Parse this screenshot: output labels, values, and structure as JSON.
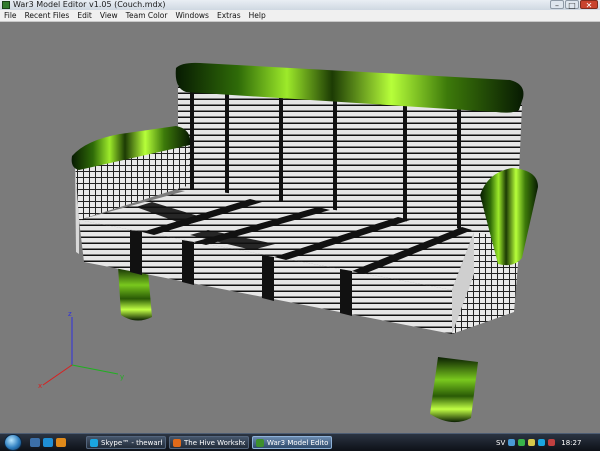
{
  "window": {
    "title": "War3 Model Editor v1.05 (Couch.mdx)",
    "controls": {
      "minimize": "–",
      "maximize": "□",
      "close": "✕"
    }
  },
  "menubar": {
    "items": [
      "File",
      "Recent Files",
      "Edit",
      "View",
      "Team Color",
      "Windows",
      "Extras",
      "Help"
    ]
  },
  "viewport": {
    "model_icon": "couch-model",
    "background_color": "#7b7b7b",
    "axes": {
      "z_label": "z",
      "y_label": "y",
      "x_label": "x",
      "x_color": "#d82020",
      "y_color": "#20b020",
      "z_color": "#3030e0"
    }
  },
  "taskbar": {
    "start_icon": "windows-start-orb",
    "tasks": [
      {
        "label": "Skype™ - thewarhu...",
        "icon": "skype-icon"
      },
      {
        "label": "The Hive Workshop ...",
        "icon": "firefox-icon"
      },
      {
        "label": "War3 Model Editor v...",
        "icon": "war3-model-editor-icon"
      }
    ],
    "language": "SV",
    "clock": "18:27"
  }
}
